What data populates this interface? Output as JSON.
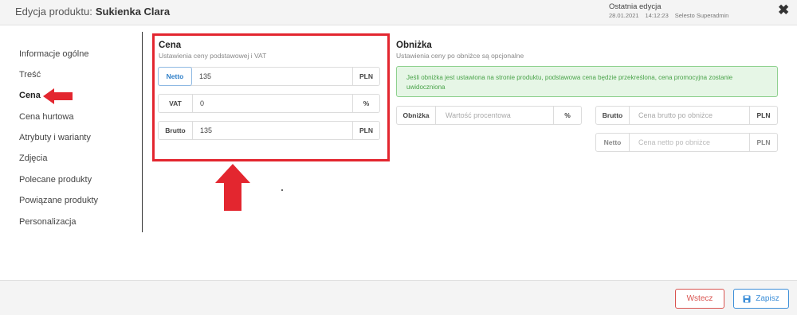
{
  "header": {
    "title_prefix": "Edycja produktu:",
    "product_name": "Sukienka Clara",
    "last_edit_label": "Ostatnia edycja",
    "last_edit_date": "28.01.2021",
    "last_edit_time": "14:12:23",
    "last_edit_user": "Selesto Superadmin",
    "close_icon": "close-icon"
  },
  "sidebar": {
    "items": [
      {
        "label": "Informacje ogólne"
      },
      {
        "label": "Treść"
      },
      {
        "label": "Cena"
      },
      {
        "label": "Cena hurtowa"
      },
      {
        "label": "Atrybuty i warianty"
      },
      {
        "label": "Zdjęcia"
      },
      {
        "label": "Polecane produkty"
      },
      {
        "label": "Powiązane produkty"
      },
      {
        "label": "Personalizacja"
      }
    ],
    "active_index": 2
  },
  "price": {
    "title": "Cena",
    "subtitle": "Ustawienia ceny podstawowej i VAT",
    "netto": {
      "label": "Netto",
      "value": "135",
      "suffix": "PLN"
    },
    "vat": {
      "label": "VAT",
      "value": "0",
      "suffix": "%"
    },
    "brutto": {
      "label": "Brutto",
      "value": "135",
      "suffix": "PLN"
    }
  },
  "discount": {
    "title": "Obniżka",
    "subtitle": "Ustawienia ceny po obniżce są opcjonalne",
    "alert": "Jeśli obniżka jest ustawiona na stronie produktu, podstawowa cena będzie przekreślona, cena promocyjna zostanie uwidoczniona",
    "percent": {
      "label": "Obniżka",
      "placeholder": "Wartość procentowa",
      "suffix": "%"
    },
    "brutto": {
      "label": "Brutto",
      "placeholder": "Cena brutto po obniżce",
      "suffix": "PLN"
    },
    "netto": {
      "label": "Netto",
      "placeholder": "Cena netto po obniżce",
      "suffix": "PLN"
    }
  },
  "footer": {
    "back_label": "Wstecz",
    "save_label": "Zapisz",
    "save_icon": "floppy-disk-icon"
  },
  "colors": {
    "highlight_red": "#e3262f",
    "accent_blue": "#3b8ed8",
    "alert_green": "#4aa34a"
  }
}
